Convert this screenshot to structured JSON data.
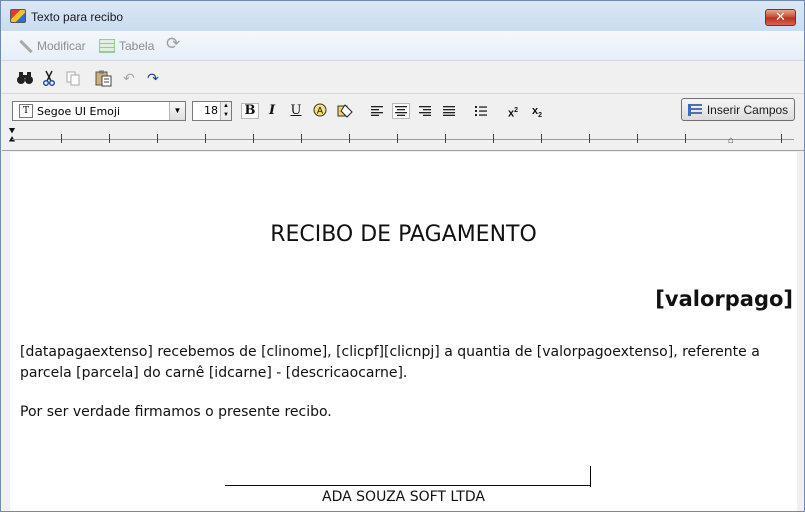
{
  "window": {
    "title": "Texto para recibo"
  },
  "toolbar1": {
    "modify_label": "Modificar",
    "table_label": "Tabela"
  },
  "format": {
    "font_name": "Segoe UI Emoji",
    "font_size": "18",
    "insert_fields_label": "Inserir Campos"
  },
  "document": {
    "title": "RECIBO DE PAGAMENTO",
    "value": "[valorpago]",
    "paragraph": "[datapagaextenso] recebemos de [clinome],  [clicpf][clicnpj] a quantia de [valorpagoextenso], referente a parcela [parcela] do carnê [idcarne] - [descricaocarne].",
    "closing": "Por ser verdade firmamos o presente recibo.",
    "company": "ADA SOUZA SOFT LTDA"
  },
  "icons": {
    "app": "app-logo-icon",
    "close": "close-icon",
    "modify": "pencil-icon",
    "table": "table-icon",
    "refresh": "refresh-icon",
    "find": "binoculars-icon",
    "cut": "scissors-icon",
    "copy": "copy-icon",
    "paste": "paste-icon",
    "undo": "undo-icon",
    "redo": "redo-icon",
    "bold": "bold-icon",
    "italic": "italic-icon",
    "underline": "underline-icon",
    "highlight": "highlight-icon",
    "fill": "fill-icon",
    "align_left": "align-left-icon",
    "align_center": "align-center-icon",
    "align_right": "align-right-icon",
    "justify": "justify-icon",
    "bullets": "bullet-list-icon",
    "superscript": "superscript-icon",
    "subscript": "subscript-icon",
    "insert_fields": "insert-fields-icon"
  }
}
